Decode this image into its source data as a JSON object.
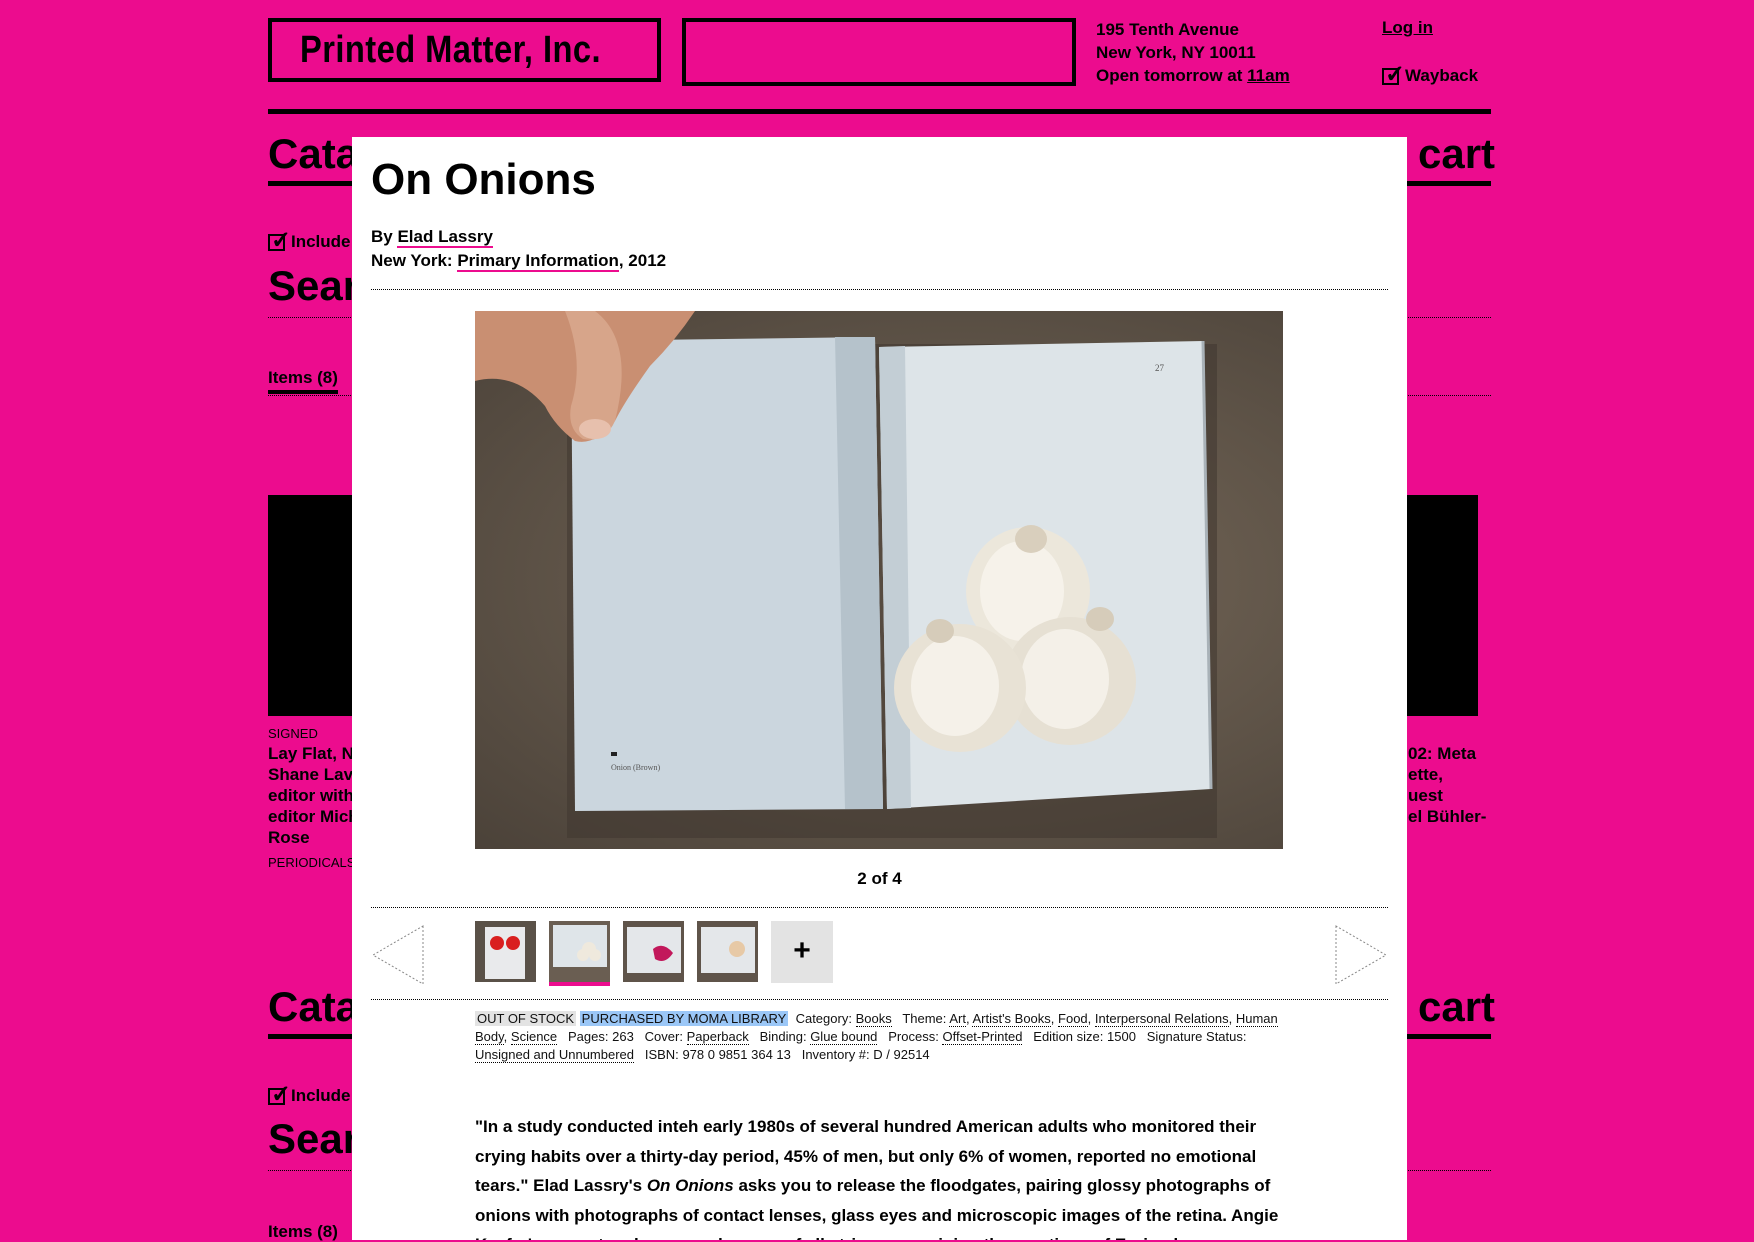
{
  "header": {
    "logo": "Printed Matter, Inc.",
    "address_line1": "195 Tenth Avenue",
    "address_line2": "New York, NY 10011",
    "hours_prefix": "Open tomorrow at",
    "hours_time": "11am",
    "login": "Log in",
    "wayback": "Wayback"
  },
  "background": {
    "cata": "Cata",
    "cart": "cart",
    "include": "Include",
    "sear": "Sear",
    "items": "Items (8)",
    "signed": "SIGNED",
    "left_card": [
      "Lay Flat, N",
      "Shane Lav",
      "editor with",
      "editor Mich",
      "Rose"
    ],
    "periodicals": "PERIODICALS",
    "right_card": [
      "02: Meta",
      "ette,",
      "uest",
      "el Bühler-"
    ]
  },
  "modal": {
    "title": "On Onions",
    "by_prefix": "By",
    "author": "Elad Lassry",
    "place": "New York:",
    "publisher": "Primary Information",
    "year": ", 2012",
    "counter": "2 of 4",
    "plus": "+",
    "page_number": "27",
    "caption": "Onion (Brown)",
    "meta": {
      "out_of_stock": "OUT OF STOCK",
      "moma": "PURCHASED BY MOMA LIBRARY",
      "category_label": "Category:",
      "category": "Books",
      "theme_label": "Theme:",
      "themes": [
        "Art",
        "Artist's Books",
        "Food",
        "Interpersonal Relations",
        "Human Body",
        "Science"
      ],
      "pages_label": "Pages:",
      "pages": "263",
      "cover_label": "Cover:",
      "cover": "Paperback",
      "binding_label": "Binding:",
      "binding": "Glue bound",
      "process_label": "Process:",
      "process": "Offset-Printed",
      "edition_label": "Edition size:",
      "edition": "1500",
      "signature_label": "Signature Status:",
      "signature": "Unsigned and Unnumbered",
      "isbn_label": "ISBN:",
      "isbn": "978 0 9851 364 13",
      "inventory_label": "Inventory #:",
      "inventory": "D / 92514"
    },
    "desc_1": "\"In a study conducted inteh early 1980s of several hundred American adults who monitored their crying habits over a thirty-day period, 45% of men, but only 6% of women, reported no emotional tears.\" Elad Lassry's",
    "desc_title": "On Onions",
    "desc_2": "asks you to release the floodgates, pairing glossy photographs of onions with photographs of contact lenses, glass eyes and microscopic images of the retina.",
    "desc_3": "Angie Keefer's essay touches on sadnesses of all stripes, examining the emotions of Euripedes"
  }
}
